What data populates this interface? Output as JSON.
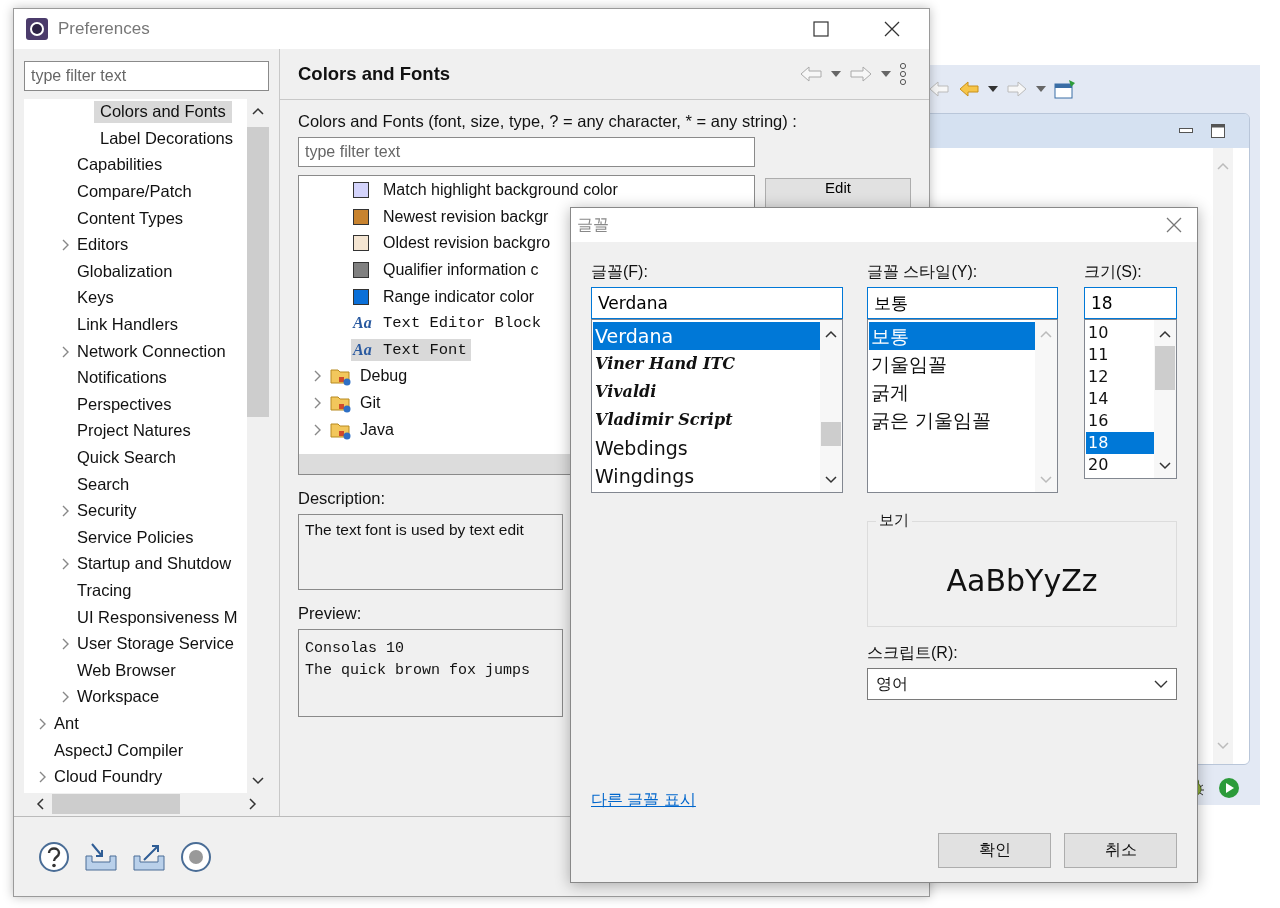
{
  "preferences": {
    "title": "Preferences",
    "filter_placeholder": "type filter text",
    "tree": [
      {
        "children": [
          {
            "children": [
              {
                "label": "Colors and Fonts",
                "selected": true
              },
              {
                "label": "Label Decorations",
                "selected": false
              }
            ]
          },
          {
            "label": "Capabilities",
            "selected": false
          },
          {
            "label": "Compare/Patch",
            "selected": false
          },
          {
            "label": "Content Types",
            "selected": false
          },
          {
            "label": "Editors",
            "selected": false,
            "expanded": false
          },
          {
            "label": "Globalization",
            "selected": false
          },
          {
            "label": "Keys",
            "selected": false
          },
          {
            "label": "Link Handlers",
            "selected": false
          },
          {
            "label": "Network Connection",
            "selected": false,
            "expanded": false
          },
          {
            "label": "Notifications",
            "selected": false
          },
          {
            "label": "Perspectives",
            "selected": false
          },
          {
            "label": "Project Natures",
            "selected": false
          },
          {
            "label": "Quick Search",
            "selected": false
          },
          {
            "label": "Search",
            "selected": false
          },
          {
            "label": "Security",
            "selected": false,
            "expanded": false
          },
          {
            "label": "Service Policies",
            "selected": false
          },
          {
            "label": "Startup and Shutdow",
            "selected": false,
            "expanded": false
          },
          {
            "label": "Tracing",
            "selected": false
          },
          {
            "label": "UI Responsiveness M",
            "selected": false
          },
          {
            "label": "User Storage Service",
            "selected": false,
            "expanded": false
          },
          {
            "label": "Web Browser",
            "selected": false
          },
          {
            "label": "Workspace",
            "selected": false,
            "expanded": false
          }
        ]
      },
      {
        "label": "Ant",
        "selected": false,
        "expanded": false
      },
      {
        "label": "AspectJ Compiler",
        "selected": false
      },
      {
        "label": "Cloud Foundry",
        "selected": false,
        "expanded": false
      }
    ],
    "page_title": "Colors and Fonts",
    "page_label": "Colors and Fonts (font, size, type, ? = any character, * = any string) :",
    "page_filter_placeholder": "type filter text",
    "items": [
      {
        "kind": "color",
        "label": "Match highlight background color",
        "color": "#d4d4fc",
        "selected": false
      },
      {
        "kind": "color",
        "label": "Newest revision backgr",
        "color": "#c8832f",
        "selected": false
      },
      {
        "kind": "color",
        "label": "Oldest revision backgro",
        "color": "#f4e5d2",
        "selected": false
      },
      {
        "kind": "color",
        "label": "Qualifier information c",
        "color": "#808080",
        "selected": false
      },
      {
        "kind": "color",
        "label": "Range indicator color",
        "color": "#0a6fd8",
        "selected": false
      },
      {
        "kind": "font",
        "icon_text": "Aa",
        "label": "Text Editor Block",
        "selected": false
      },
      {
        "kind": "font",
        "icon_text": "Aa",
        "label": "Text Font",
        "selected": true
      },
      {
        "kind": "category",
        "label": "Debug",
        "expanded": false,
        "selected": false
      },
      {
        "kind": "category",
        "label": "Git",
        "expanded": false,
        "selected": false
      },
      {
        "kind": "category",
        "label": "Java",
        "expanded": false,
        "selected": false
      }
    ],
    "edit_button": "Edit",
    "description_label": "Description:",
    "description": "The text font is used by text edit",
    "preview_label": "Preview:",
    "preview_lines": [
      "Consolas 10",
      "The quick brown fox jumps"
    ]
  },
  "font_dialog": {
    "title": "글꼴",
    "font_label": "글꼴(F):",
    "font_value": "Verdana",
    "fonts": [
      {
        "name": "Verdana",
        "kind": "plain",
        "selected": true
      },
      {
        "name": "Viner Hand ITC",
        "kind": "script",
        "selected": false
      },
      {
        "name": "Vivaldi",
        "kind": "script",
        "selected": false
      },
      {
        "name": "Vladimir Script",
        "kind": "script",
        "selected": false
      },
      {
        "name": "Webdings",
        "kind": "plain",
        "selected": false
      },
      {
        "name": "Wingdings",
        "kind": "plain",
        "selected": false
      }
    ],
    "style_label": "글꼴 스타일(Y):",
    "style_value": "보통",
    "styles": [
      {
        "name": "보통",
        "selected": true
      },
      {
        "name": "기울임꼴",
        "selected": false
      },
      {
        "name": "굵게",
        "selected": false
      },
      {
        "name": "굵은 기울임꼴",
        "selected": false
      }
    ],
    "size_label": "크기(S):",
    "size_value": "18",
    "sizes": [
      {
        "name": "10",
        "selected": false
      },
      {
        "name": "11",
        "selected": false
      },
      {
        "name": "12",
        "selected": false
      },
      {
        "name": "14",
        "selected": false
      },
      {
        "name": "16",
        "selected": false
      },
      {
        "name": "18",
        "selected": true
      },
      {
        "name": "20",
        "selected": false
      }
    ],
    "preview_label": "보기",
    "preview_text": "AaBbYyZz",
    "script_label": "스크립트(R):",
    "script_value": "영어",
    "link": "다른 글꼴 표시",
    "buttons": [
      "확인",
      "취소"
    ]
  }
}
